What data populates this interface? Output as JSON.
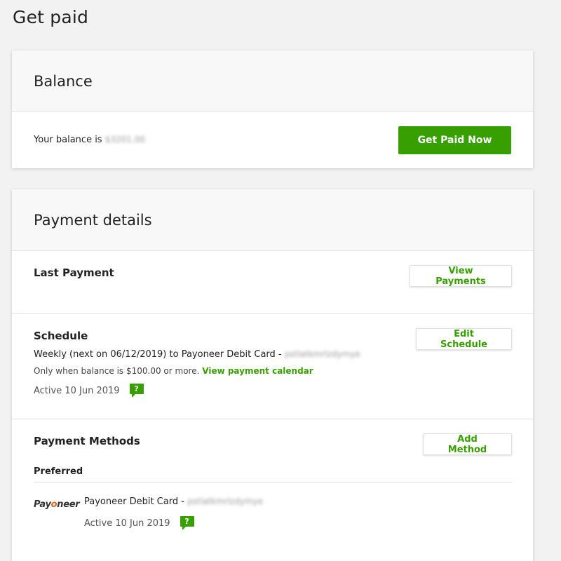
{
  "page": {
    "title": "Get paid"
  },
  "balance": {
    "heading": "Balance",
    "label": "Your balance is",
    "amount": "$3201.00",
    "button_label": "Get Paid Now"
  },
  "payment_details": {
    "heading": "Payment details",
    "last_payment": {
      "title": "Last Payment",
      "button_label": "View Payments"
    },
    "schedule": {
      "title": "Schedule",
      "frequency_text": "Weekly (next on 06/12/2019) to Payoneer Debit Card -",
      "account_masked": "pstlatkmrlzdymye",
      "condition_text": "Only when balance is $100.00 or more.",
      "calendar_link": "View payment calendar",
      "active_text": "Active 10 Jun 2019",
      "button_label": "Edit Schedule"
    },
    "methods": {
      "title": "Payment Methods",
      "button_label": "Add Method",
      "preferred_label": "Preferred",
      "items": [
        {
          "logo_text_pre": "Pay",
          "logo_text_accent": "o",
          "logo_text_post": "neer",
          "name": "Payoneer Debit Card -",
          "account_masked": "pstlatkmrlzdymye",
          "active_text": "Active 10 Jun 2019"
        }
      ]
    }
  },
  "icons": {
    "help": "question-bubble-icon",
    "help_glyph": "?"
  },
  "colors": {
    "accent": "#37a000",
    "background": "#f2f2f2",
    "payoneer_orange": "#e8641c"
  }
}
